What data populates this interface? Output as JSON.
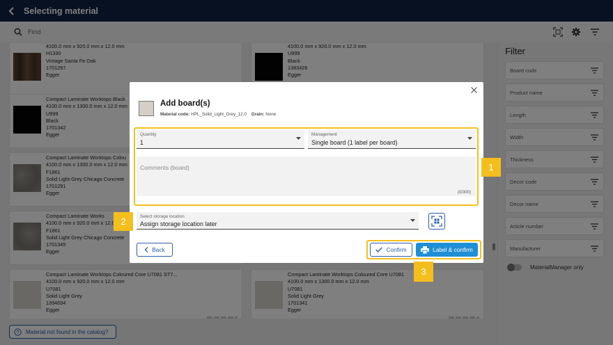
{
  "topbar": {
    "title": "Selecting material"
  },
  "search": {
    "placeholder": "Find"
  },
  "catalog": {
    "items": [
      {
        "lines": [
          "4100.0 mm x 920.0 mm x 12.0 mm",
          "H1330",
          "Vintage Santa Fe Oak",
          "1701297",
          "Egger"
        ]
      },
      {
        "lines": [
          "4100.0 mm x 920.0 mm x 12.0 mm",
          "U999",
          "Black",
          "1383426",
          "Egger"
        ]
      },
      {
        "lines": [
          "Compact Laminate Worktops Black",
          "4100.0 mm x 1300.0 mm x 12.0 mm",
          "U999",
          "Black",
          "1701342",
          "Egger"
        ]
      },
      {
        "lines": [
          "Compact Laminate Worktops Colou",
          "4100.0 mm x 1300.0 mm x 12.0 mm",
          "F1861",
          "Solid Light Grey Chicago Concrete",
          "1701291",
          "Egger"
        ]
      },
      {
        "lines": [
          "Compact Laminate Works",
          "4100.0 mm x 920.0 mm x 12.0 mm",
          "F1861",
          "Solid Light Grey Chicago Concrete",
          "1701345",
          "Egger"
        ]
      },
      {
        "lines": [
          "Compact Laminate Worktops Coloured Core U7081 ST7...",
          "4100.0 mm x 920.0 mm x 12.0 mm",
          "U7081",
          "Solid Light Grey",
          "1394694",
          "Egger"
        ]
      },
      {
        "lines": [
          "Compact Laminate Worktops Coloured Core U7081",
          "4100.0 mm x 1300.0 mm x 12.0 mm",
          "U7081",
          "Solid Light Grey",
          "1701341",
          "Egger"
        ]
      }
    ],
    "not_found_label": "Material not found in the catalog?"
  },
  "filter": {
    "title": "Filter",
    "rows": [
      "Board code",
      "Product name",
      "Length",
      "Width",
      "Thickness",
      "Decor code",
      "Decor name",
      "Article number",
      "Manufacturer"
    ],
    "toggle_label": "MaterialManager only"
  },
  "dialog": {
    "title": "Add board(s)",
    "material_code_label": "Material code:",
    "material_code": "HPL_Solid_Light_Grey_12.0",
    "grain_label": "Grain:",
    "grain": "None",
    "quantity": {
      "label": "Quantity",
      "value": "1"
    },
    "management": {
      "label": "Management",
      "value": "Single board (1 label per board)"
    },
    "comments": {
      "placeholder": "Comments (board)",
      "counter": "(0/300)"
    },
    "storage": {
      "label": "Select storage location",
      "value": "Assign storage location later"
    },
    "back_label": "Back",
    "confirm_label": "Confirm",
    "label_confirm_label": "Label & confirm"
  },
  "badges": [
    "1",
    "2",
    "3"
  ],
  "colors": {
    "topbar": "#0e2344",
    "highlight": "#f4bf1c",
    "primary": "#1e8fd6",
    "outline": "#2b5ea8"
  }
}
